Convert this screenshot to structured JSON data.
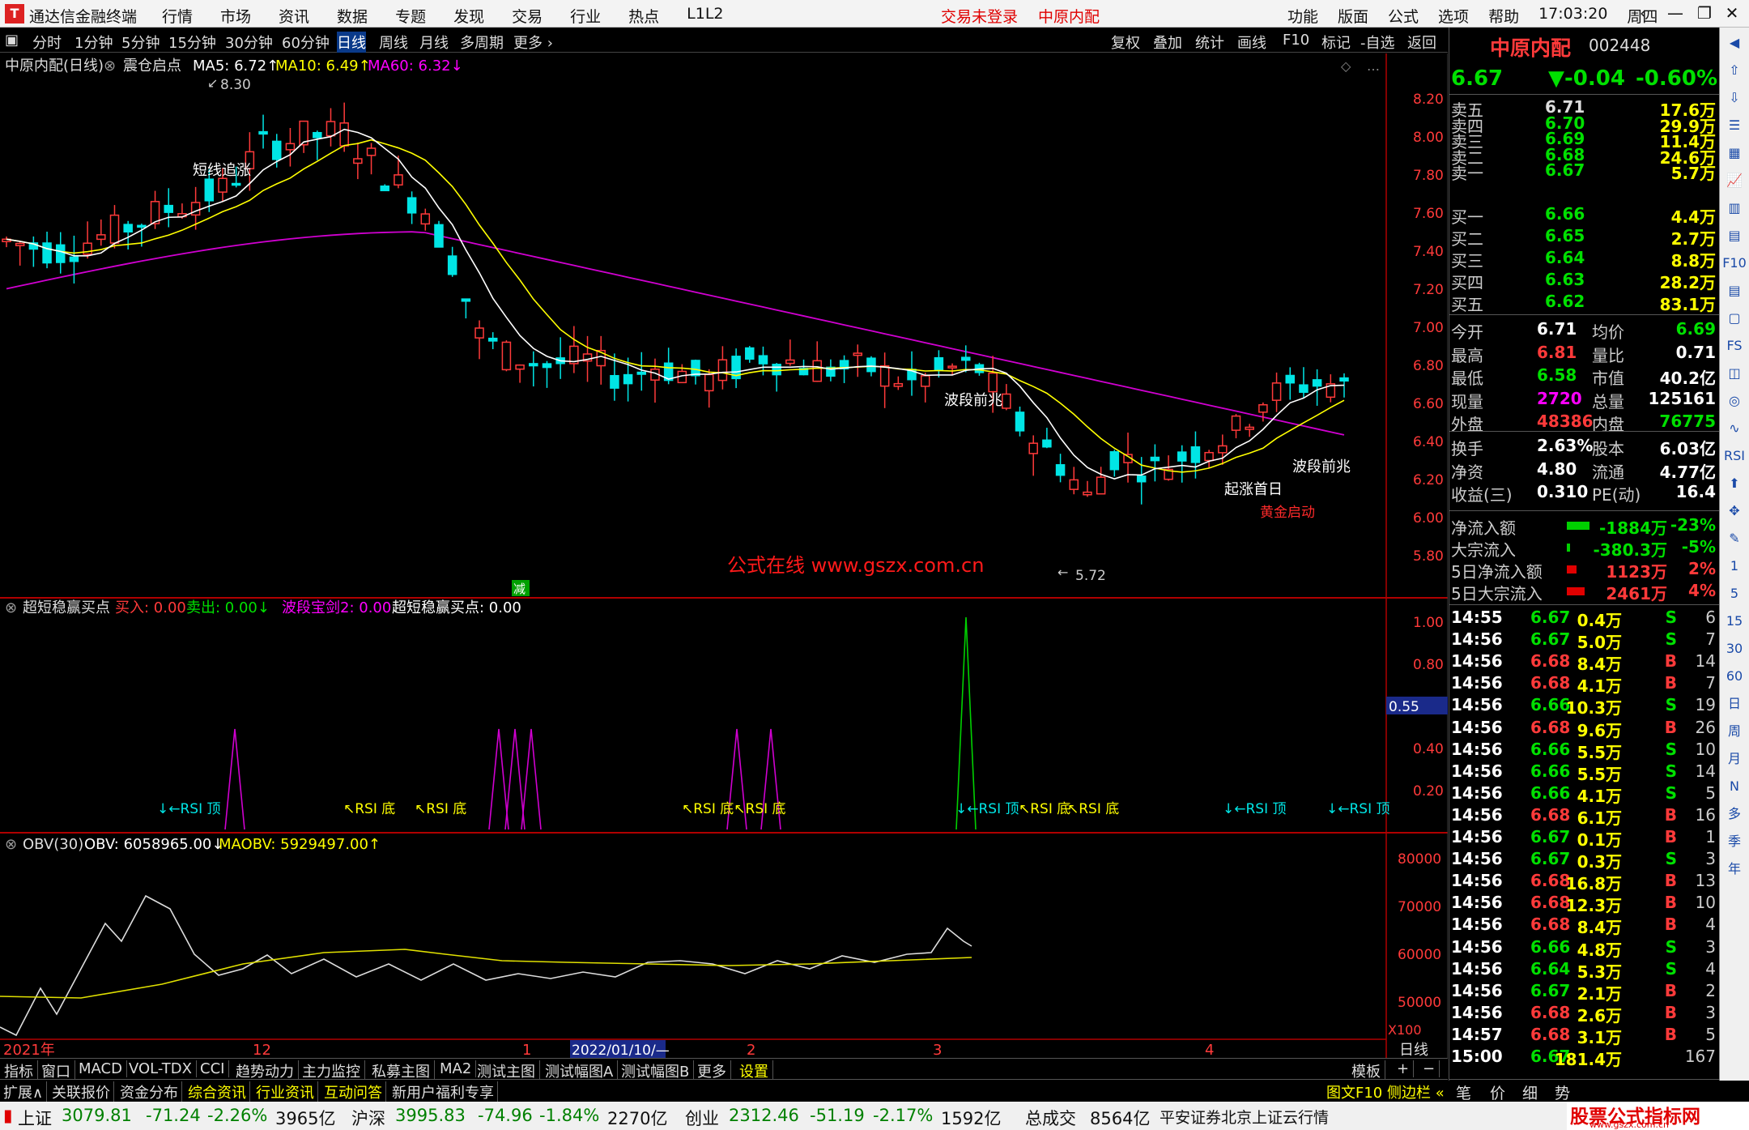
{
  "app": {
    "title": "通达信金融终端",
    "logo_char": "T"
  },
  "menu": [
    "行情",
    "市场",
    "资讯",
    "数据",
    "专题",
    "发现",
    "交易",
    "行业",
    "热点",
    "L1L2"
  ],
  "trade_status": "交易未登录",
  "header_stock": "中原内配",
  "right_menu": [
    "功能",
    "版面",
    "公式",
    "选项",
    "帮助"
  ],
  "clock": "17:03:20",
  "weekday": "周四",
  "periods": [
    "分时",
    "1分钟",
    "5分钟",
    "15分钟",
    "30分钟",
    "60分钟",
    "日线",
    "周线",
    "月线",
    "多周期",
    "更多 ›"
  ],
  "selected_period": "日线",
  "tools": [
    "复权",
    "叠加",
    "统计",
    "画线",
    "F10",
    "标记",
    "-自选",
    "返回"
  ],
  "chart_info": {
    "name": "中原内配(日线)",
    "indicator": "震仓启点",
    "ma5": "MA5: 6.72↑",
    "ma10": "MA10: 6.49↑",
    "ma60": "MA60: 6.32↓"
  },
  "annotations": {
    "high": "8.30",
    "low": "5.72",
    "a1": "短线追涨",
    "a2": "波段前兆",
    "a3": "波段前兆",
    "a4": "起涨首日",
    "a5": "黄金启动",
    "watermark": "公式在线  www.gszx.com.cn",
    "minus": "减"
  },
  "price_axis": [
    "8.20",
    "8.00",
    "7.80",
    "7.60",
    "7.40",
    "7.20",
    "7.00",
    "6.80",
    "6.60",
    "6.40",
    "6.20",
    "6.00",
    "5.80"
  ],
  "panel2": {
    "title": "超短稳赢买点",
    "buy": "买入: 0.00",
    "sell": "卖出: 0.00↓",
    "wave": "波段宝剑2: 0.00",
    "pts": "超短稳赢买点: 0.00",
    "axis": [
      "1.00",
      "0.80",
      "0.40",
      "0.20"
    ],
    "cursor": "0.55",
    "labels": [
      "↓←RSI 顶",
      "↖RSI 底",
      "↖RSI 底",
      "↖RSI 底↖RSI 底",
      "↓←RSI 顶",
      "↖RSI 底",
      "↖RSI 底",
      "↓←RSI 顶",
      "↓←RSI 顶"
    ]
  },
  "panel3": {
    "title": "OBV(30)",
    "obv": "OBV: 6058965.00↓",
    "maobv": "MAOBV: 5929497.00↑",
    "axis": [
      "80000",
      "70000",
      "60000",
      "50000"
    ],
    "unit": "X100"
  },
  "time_axis": {
    "labels": [
      "2021年",
      "12",
      "1",
      "2",
      "3",
      "4"
    ],
    "cursor": "2022/01/10/—",
    "period": "日线"
  },
  "tabs1": [
    "指标",
    "窗口",
    "MACD",
    "VOL-TDX",
    "CCI",
    "趋势动力",
    "主力监控",
    "私募主图",
    "MA2",
    "测试主图",
    "测试幅图A",
    "测试幅图B",
    "更多",
    "设置"
  ],
  "tabs1_right": [
    "模板",
    "+",
    "−"
  ],
  "tabs2": [
    "扩展∧",
    "关联报价",
    "资金分布",
    "综合资讯",
    "行业资讯",
    "互动问答",
    "新用户福利专享"
  ],
  "tabs2_right": "图文F10 侧边栏 «",
  "quote": {
    "name": "中原内配",
    "code": "002448",
    "price": "6.67",
    "change": "▼-0.04",
    "pct": "-0.60%",
    "asks": [
      {
        "l": "卖五",
        "p": "6.71",
        "v": "17.6万"
      },
      {
        "l": "卖四",
        "p": "6.70",
        "v": "29.9万"
      },
      {
        "l": "卖三",
        "p": "6.69",
        "v": "11.4万"
      },
      {
        "l": "卖二",
        "p": "6.68",
        "v": "24.6万"
      },
      {
        "l": "卖一",
        "p": "6.67",
        "v": "5.7万"
      }
    ],
    "bids": [
      {
        "l": "买一",
        "p": "6.66",
        "v": "4.4万"
      },
      {
        "l": "买二",
        "p": "6.65",
        "v": "2.7万"
      },
      {
        "l": "买三",
        "p": "6.64",
        "v": "8.8万"
      },
      {
        "l": "买四",
        "p": "6.63",
        "v": "28.2万"
      },
      {
        "l": "买五",
        "p": "6.62",
        "v": "83.1万"
      }
    ],
    "stats": [
      [
        "今开",
        "6.71",
        "均价",
        "6.69"
      ],
      [
        "最高",
        "6.81",
        "量比",
        "0.71"
      ],
      [
        "最低",
        "6.58",
        "市值",
        "40.2亿"
      ],
      [
        "现量",
        "2720",
        "总量",
        "125161"
      ],
      [
        "外盘",
        "48386",
        "内盘",
        "76775"
      ]
    ],
    "stats2": [
      [
        "换手",
        "2.63%",
        "股本",
        "6.03亿"
      ],
      [
        "净资",
        "4.80",
        "流通",
        "4.77亿"
      ],
      [
        "收益(三)",
        "0.310",
        "PE(动)",
        "16.4"
      ]
    ],
    "flows": [
      [
        "净流入额",
        "-1884万",
        "-23%"
      ],
      [
        "大宗流入",
        "-380.3万",
        "-5%"
      ],
      [
        "5日净流入额",
        "1123万",
        "2%"
      ],
      [
        "5日大宗流入",
        "2461万",
        "4%"
      ]
    ],
    "ticks": [
      [
        "14:55",
        "6.67",
        "0.4万",
        "S",
        "6"
      ],
      [
        "14:56",
        "6.67",
        "5.0万",
        "S",
        "7"
      ],
      [
        "14:56",
        "6.68",
        "8.4万",
        "B",
        "14"
      ],
      [
        "14:56",
        "6.68",
        "4.1万",
        "B",
        "7"
      ],
      [
        "14:56",
        "6.66",
        "10.3万",
        "S",
        "19"
      ],
      [
        "14:56",
        "6.68",
        "9.6万",
        "B",
        "26"
      ],
      [
        "14:56",
        "6.66",
        "5.5万",
        "S",
        "10"
      ],
      [
        "14:56",
        "6.66",
        "5.5万",
        "S",
        "14"
      ],
      [
        "14:56",
        "6.66",
        "4.1万",
        "S",
        "5"
      ],
      [
        "14:56",
        "6.68",
        "6.1万",
        "B",
        "16"
      ],
      [
        "14:56",
        "6.67",
        "0.1万",
        "B",
        "1"
      ],
      [
        "14:56",
        "6.67",
        "0.3万",
        "S",
        "3"
      ],
      [
        "14:56",
        "6.68",
        "16.8万",
        "B",
        "13"
      ],
      [
        "14:56",
        "6.68",
        "12.3万",
        "B",
        "10"
      ],
      [
        "14:56",
        "6.68",
        "8.4万",
        "B",
        "4"
      ],
      [
        "14:56",
        "6.66",
        "4.8万",
        "S",
        "3"
      ],
      [
        "14:56",
        "6.64",
        "5.3万",
        "S",
        "4"
      ],
      [
        "14:56",
        "6.67",
        "2.1万",
        "B",
        "2"
      ],
      [
        "14:56",
        "6.68",
        "2.6万",
        "B",
        "3"
      ],
      [
        "14:57",
        "6.68",
        "3.1万",
        "B",
        "5"
      ],
      [
        "15:00",
        "6.67",
        "181.4万",
        "",
        "167"
      ]
    ],
    "bottom_tabs": [
      "笔",
      "价",
      "细",
      "势"
    ]
  },
  "side_icons": [
    "RSI",
    "F10",
    "FS",
    "1",
    "5",
    "15",
    "30",
    "60",
    "日",
    "周",
    "月",
    "N",
    "多",
    "季",
    "年"
  ],
  "status": {
    "sh_name": "上证",
    "sh": "3079.81",
    "sh_chg": "-71.24",
    "sh_pct": "-2.26%",
    "sh_amt": "3965亿",
    "sz_name": "沪深",
    "sz": "3995.83",
    "sz_chg": "-74.96",
    "sz_pct": "-1.84%",
    "sz_amt": "2270亿",
    "cy_name": "创业",
    "cy": "2312.46",
    "cy_chg": "-51.19",
    "cy_pct": "-2.17%",
    "cy_amt": "1592亿",
    "total_name": "总成交",
    "total": "8564亿",
    "server": "平安证券北京上证云行情",
    "brand": "股票公式指标网",
    "brand_url": "www.gszx.com.cn"
  },
  "colors": {
    "up": "#ff3a3a",
    "down": "#00e5e5",
    "ma5": "#ffffff",
    "ma10": "#ffff00",
    "ma60": "#d000d0"
  }
}
